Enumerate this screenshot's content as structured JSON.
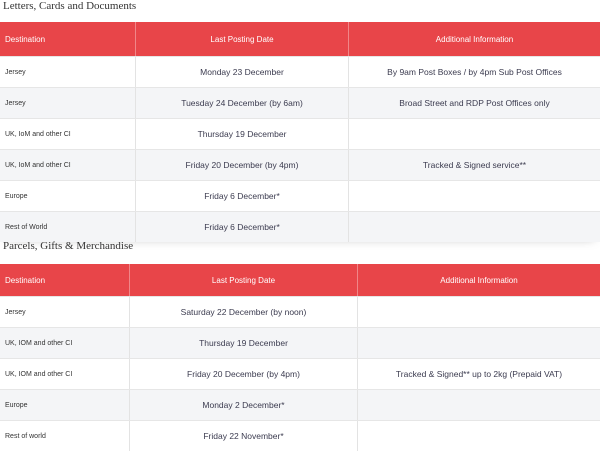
{
  "sections": [
    {
      "title": "Letters, Cards and Documents",
      "headers": [
        "Destination",
        "Last Posting Date",
        "Additional Information"
      ],
      "rows": [
        [
          "Jersey",
          "Monday 23 December",
          "By 9am Post Boxes / by 4pm Sub Post Offices"
        ],
        [
          "Jersey",
          "Tuesday 24 December (by 6am)",
          "Broad Street and RDP Post Offices only"
        ],
        [
          "UK, IoM and other CI",
          "Thursday 19 December",
          ""
        ],
        [
          "UK, IoM and other CI",
          "Friday 20 December (by 4pm)",
          "Tracked & Signed service**"
        ],
        [
          "Europe",
          "Friday 6 December*",
          ""
        ],
        [
          "Rest of World",
          "Friday 6 December*",
          ""
        ]
      ]
    },
    {
      "title": "Parcels, Gifts & Merchandise",
      "headers": [
        "Destination",
        "Last Posting Date",
        "Additional Information"
      ],
      "rows": [
        [
          "Jersey",
          "Saturday 22 December (by noon)",
          ""
        ],
        [
          "UK, IOM and other CI",
          "Thursday 19 December",
          ""
        ],
        [
          "UK, IOM and other CI",
          "Friday 20 December (by 4pm)",
          "Tracked & Signed** up to 2kg (Prepaid VAT)"
        ],
        [
          "Europe",
          "Monday 2 December*",
          ""
        ],
        [
          "Rest of world",
          "Friday 22 November*",
          ""
        ]
      ]
    }
  ],
  "colors": {
    "header_bg": "#e84549",
    "alt_row_bg": "#f4f5f7"
  }
}
